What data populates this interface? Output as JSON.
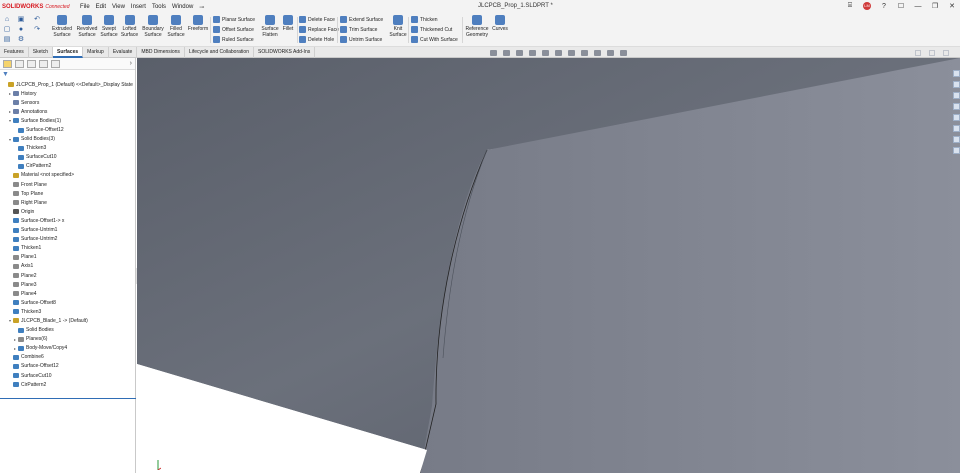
{
  "titlebar": {
    "brand_logo": "SOLID",
    "brand_works": "WORKS",
    "connected": "Connected",
    "menus": [
      "File",
      "Edit",
      "View",
      "Insert",
      "Tools",
      "Window"
    ],
    "pin_icon": "pin-icon",
    "document": "JLCPCB_Prop_1.SLDPRT *",
    "window_buttons": [
      "terminal-icon",
      "user-avatar",
      "help-icon",
      "maximize-icon",
      "minimize-icon",
      "restore-icon",
      "close-icon"
    ],
    "avatar_text": "LM"
  },
  "ribbon": {
    "big_tools": [
      {
        "label": "Extruded\nSurface",
        "icon": "extruded-surface-icon"
      },
      {
        "label": "Revolved\nSurface",
        "icon": "revolved-surface-icon"
      },
      {
        "label": "Swept\nSurface",
        "icon": "swept-surface-icon"
      },
      {
        "label": "Lofted\nSurface",
        "icon": "lofted-surface-icon"
      },
      {
        "label": "Boundary\nSurface",
        "icon": "boundary-surface-icon"
      },
      {
        "label": "Filled\nSurface",
        "icon": "filled-surface-icon"
      },
      {
        "label": "Freeform",
        "icon": "freeform-icon"
      }
    ],
    "col1": [
      "Planar Surface",
      "Offset Surface",
      "Ruled Surface"
    ],
    "flatten_label": "Surface\nFlatten",
    "fillet_label": "Fillet",
    "col2": [
      "Delete Face",
      "Replace Face",
      "Delete Hole"
    ],
    "col3": [
      "Extend Surface",
      "Trim Surface",
      "Untrim Surface"
    ],
    "knit_label": "Knit\nSurface",
    "col4": [
      "Thicken",
      "Thickened Cut",
      "Cut With Surface"
    ],
    "reference_label": "Reference\nGeometry",
    "curves_label": "Curves"
  },
  "tabs": [
    "Features",
    "Sketch",
    "Surfaces",
    "Markup",
    "Evaluate",
    "MBD Dimensions",
    "Lifeсycle and Collaboration",
    "SOLIDWORKS Add-Ins"
  ],
  "active_tab": "Surfaces",
  "tree": [
    {
      "label": "JLCPCB_Prop_1 (Default) <<Default>_Display State",
      "indent": 0,
      "arrow": "",
      "color": "#c9a227"
    },
    {
      "label": "History",
      "indent": 1,
      "arrow": "▸",
      "color": "#6b7fa8"
    },
    {
      "label": "Sensors",
      "indent": 1,
      "arrow": "",
      "color": "#6b7fa8"
    },
    {
      "label": "Annotations",
      "indent": 1,
      "arrow": "▸",
      "color": "#6b7fa8"
    },
    {
      "label": "Surface Bodies(1)",
      "indent": 1,
      "arrow": "▾",
      "color": "#3f7fbf"
    },
    {
      "label": "Surface-Offset12",
      "indent": 2,
      "arrow": "",
      "color": "#3f7fbf"
    },
    {
      "label": "Solid Bodies(3)",
      "indent": 1,
      "arrow": "▾",
      "color": "#3f7fbf"
    },
    {
      "label": "Thicken3",
      "indent": 2,
      "arrow": "",
      "color": "#3f7fbf"
    },
    {
      "label": "SurfaceCut10",
      "indent": 2,
      "arrow": "",
      "color": "#3f7fbf"
    },
    {
      "label": "CirPattern2",
      "indent": 2,
      "arrow": "",
      "color": "#3f7fbf"
    },
    {
      "label": "Material <not specified>",
      "indent": 1,
      "arrow": "",
      "color": "#c9a227"
    },
    {
      "label": "Front Plane",
      "indent": 1,
      "arrow": "",
      "color": "#8a8a8a"
    },
    {
      "label": "Top Plane",
      "indent": 1,
      "arrow": "",
      "color": "#8a8a8a"
    },
    {
      "label": "Right Plane",
      "indent": 1,
      "arrow": "",
      "color": "#8a8a8a"
    },
    {
      "label": "Origin",
      "indent": 1,
      "arrow": "",
      "color": "#555555"
    },
    {
      "label": "Surface-Offset1-> x",
      "indent": 1,
      "arrow": "",
      "color": "#3f7fbf"
    },
    {
      "label": "Surface-Untrim1",
      "indent": 1,
      "arrow": "",
      "color": "#3f7fbf"
    },
    {
      "label": "Surface-Untrim2",
      "indent": 1,
      "arrow": "",
      "color": "#3f7fbf"
    },
    {
      "label": "Thicken1",
      "indent": 1,
      "arrow": "",
      "color": "#3f7fbf"
    },
    {
      "label": "Plane1",
      "indent": 1,
      "arrow": "",
      "color": "#8a8a8a"
    },
    {
      "label": "Axis1",
      "indent": 1,
      "arrow": "",
      "color": "#8a8a8a"
    },
    {
      "label": "Plane2",
      "indent": 1,
      "arrow": "",
      "color": "#8a8a8a"
    },
    {
      "label": "Plane3",
      "indent": 1,
      "arrow": "",
      "color": "#8a8a8a"
    },
    {
      "label": "Plane4",
      "indent": 1,
      "arrow": "",
      "color": "#8a8a8a"
    },
    {
      "label": "Surface-Offset8",
      "indent": 1,
      "arrow": "",
      "color": "#3f7fbf"
    },
    {
      "label": "Thicken3",
      "indent": 1,
      "arrow": "",
      "color": "#3f7fbf"
    },
    {
      "label": "JLCPCB_Blade_1 -> (Default)",
      "indent": 1,
      "arrow": "▾",
      "color": "#c9a227"
    },
    {
      "label": "Solid Bodies",
      "indent": 2,
      "arrow": "",
      "color": "#3f7fbf"
    },
    {
      "label": "Planes(6)",
      "indent": 2,
      "arrow": "▸",
      "color": "#8a8a8a"
    },
    {
      "label": "Body-Move/Copy4",
      "indent": 2,
      "arrow": "▸",
      "color": "#3f7fbf"
    },
    {
      "label": "Combine6",
      "indent": 1,
      "arrow": "",
      "color": "#3f7fbf"
    },
    {
      "label": "Surface-Offset12",
      "indent": 1,
      "arrow": "",
      "color": "#3f7fbf"
    },
    {
      "label": "SurfaceCut10",
      "indent": 1,
      "arrow": "",
      "color": "#3f7fbf"
    },
    {
      "label": "CirPattern2",
      "indent": 1,
      "arrow": "",
      "color": "#3f7fbf"
    }
  ],
  "colors": {
    "surface_dark": "#5d636f",
    "surface_light": "#878b97",
    "accent": "#2f6db5",
    "brand": "#d71920"
  }
}
